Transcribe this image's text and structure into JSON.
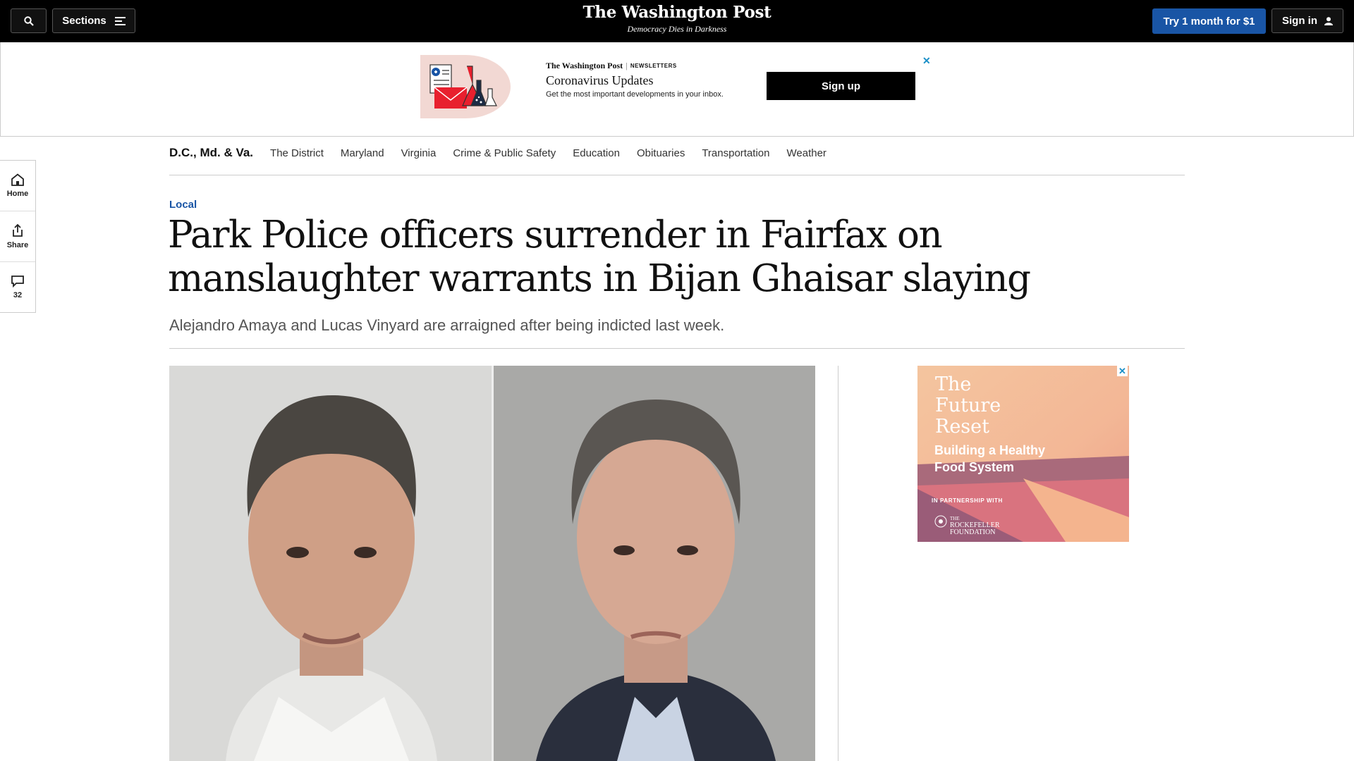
{
  "header": {
    "sections_label": "Sections",
    "logo": "The Washington Post",
    "tagline": "Democracy Dies in Darkness",
    "trial_label": "Try 1 month for $1",
    "signin_label": "Sign in"
  },
  "newsletter_ad": {
    "brand": "The Washington Post",
    "brand_suffix": "NEWSLETTERS",
    "title": "Coronavirus Updates",
    "description": "Get the most important developments in your inbox.",
    "signup_label": "Sign up",
    "close_symbol": "✕"
  },
  "section_nav": {
    "main": "D.C., Md. & Va.",
    "items": [
      "The District",
      "Maryland",
      "Virginia",
      "Crime & Public Safety",
      "Education",
      "Obituaries",
      "Transportation",
      "Weather"
    ]
  },
  "side_rail": {
    "home_label": "Home",
    "share_label": "Share",
    "comments_count": "32"
  },
  "article": {
    "kicker": "Local",
    "headline": "Park Police officers surrender in Fairfax on manslaughter warrants in Bijan Ghaisar slaying",
    "dek": "Alejandro Amaya and Lucas Vinyard are arraigned after being indicted last week."
  },
  "right_ad": {
    "title": "The Future Reset",
    "subtitle": "Building a Healthy Food System",
    "partner_label": "IN PARTNERSHIP WITH",
    "partner_prefix": "THE",
    "partner_name_1": "ROCKEFELLER",
    "partner_name_2": "FOUNDATION",
    "close_symbol": "✕"
  },
  "colors": {
    "topbar": "#000000",
    "accent_blue": "#1955a5",
    "ad_close": "#1a8fc7"
  }
}
